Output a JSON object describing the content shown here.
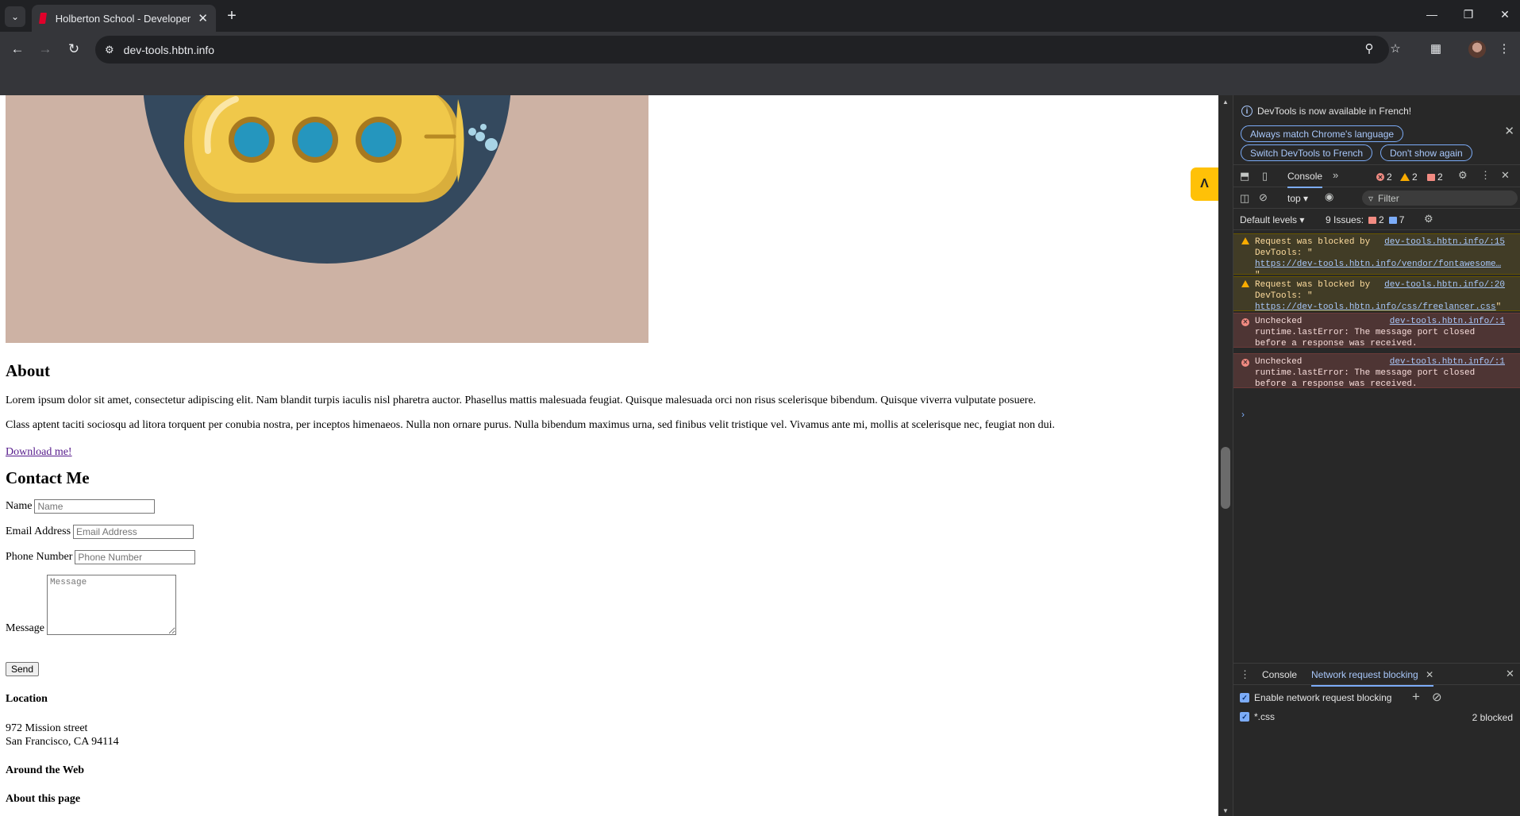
{
  "browser": {
    "tab_title": "Holberton School - Developer t",
    "url": "dev-tools.hbtn.info",
    "icons": [
      "tab-search-icon",
      "favicon",
      "close-icon",
      "plus-icon",
      "minimize-icon",
      "restore-icon",
      "close-window-icon",
      "back-icon",
      "forward-icon",
      "reload-icon",
      "site-info-icon",
      "zoom-icon",
      "star-icon",
      "extensions-icon",
      "profile-avatar",
      "menu-icon"
    ]
  },
  "page": {
    "about_heading": "About",
    "about_p1": "Lorem ipsum dolor sit amet, consectetur adipiscing elit. Nam blandit turpis iaculis nisl pharetra auctor. Phasellus mattis malesuada feugiat. Quisque malesuada orci non risus scelerisque bibendum. Quisque viverra vulputate posuere.",
    "about_p2": "Class aptent taciti sociosqu ad litora torquent per conubia nostra, per inceptos himenaeos. Nulla non ornare purus. Nulla bibendum maximus urna, sed finibus velit tristique vel. Vivamus ante mi, mollis at scelerisque nec, feugiat non dui.",
    "download_link": "Download me!",
    "contact_heading": "Contact Me",
    "form": {
      "name_label": "Name",
      "name_placeholder": "Name",
      "email_label": "Email Address",
      "email_placeholder": "Email Address",
      "phone_label": "Phone Number",
      "phone_placeholder": "Phone Number",
      "message_label": "Message",
      "message_placeholder": "Message",
      "send_label": "Send"
    },
    "location_heading": "Location",
    "address_line1": "972 Mission street",
    "address_line2": "San Francisco, CA 94114",
    "around_heading": "Around the Web",
    "about_page_heading": "About this page",
    "hero_colors": {
      "background": "#cdb2a4",
      "circle": "#2c3e50",
      "submarine": "#f0c84a",
      "porthole": "#2596be"
    }
  },
  "devtools": {
    "infobar_text": "DevTools is now available in French!",
    "btn_match": "Always match Chrome's language",
    "btn_switch": "Switch DevTools to French",
    "btn_dont": "Don't show again",
    "console_tab": "Console",
    "errors_count": "2",
    "warnings_count": "2",
    "issues_count": "2",
    "context": "top",
    "filter_placeholder": "Filter",
    "default_levels": "Default levels",
    "issues_label": "9 Issues:",
    "issues_err": "2",
    "issues_info": "7",
    "messages": [
      {
        "type": "warning",
        "text_line1": "Request was blocked by",
        "text_line2": "DevTools: \"",
        "link": "https://dev-tools.hbtn.info/vendor/fontawesome…",
        "tail": "\"",
        "source": "dev-tools.hbtn.info/:15"
      },
      {
        "type": "warning",
        "text_line1": "Request was blocked by",
        "text_line2": "DevTools: \"",
        "link": "https://dev-tools.hbtn.info/css/freelancer.css",
        "tail": "\"",
        "source": "dev-tools.hbtn.info/:20"
      },
      {
        "type": "error",
        "text_line1": "Unchecked",
        "text_line2": "runtime.lastError: The message port closed",
        "text_line3": "before a response was received.",
        "source": "dev-tools.hbtn.info/:1"
      },
      {
        "type": "error",
        "text_line1": "Unchecked",
        "text_line2": "runtime.lastError: The message port closed",
        "text_line3": "before a response was received.",
        "source": "dev-tools.hbtn.info/:1"
      }
    ],
    "drawer": {
      "tab_console": "Console",
      "tab_blocking": "Network request blocking",
      "enable_label": "Enable network request blocking",
      "pattern": "*.css",
      "blocked_count": "2 blocked"
    }
  }
}
